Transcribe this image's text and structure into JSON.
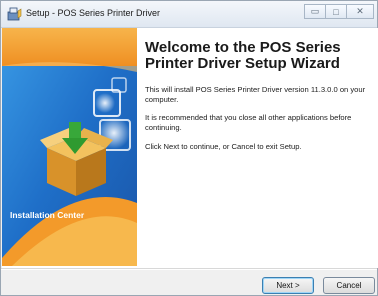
{
  "window": {
    "title": "Setup - POS Series Printer Driver",
    "buttons": {
      "minimize": "▭",
      "maximize": "□",
      "close": "✕"
    }
  },
  "banner": {
    "caption": "Installation Center",
    "colors": {
      "top": "#f4a23a",
      "mid": "#2a86d6",
      "bottom": "#1d5fb0"
    }
  },
  "main": {
    "heading": "Welcome to the POS Series Printer Driver Setup Wizard",
    "paragraphs": [
      "This will install POS Series Printer Driver version 11.3.0.0 on your computer.",
      "It is recommended that you close all other applications before continuing.",
      "Click Next to continue, or Cancel to exit Setup."
    ]
  },
  "footer": {
    "next_label": "Next >",
    "cancel_label": "Cancel"
  }
}
